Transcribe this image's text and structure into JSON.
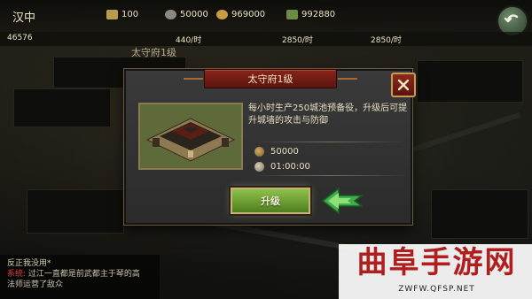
{
  "topbar": {
    "city_name": "汉中",
    "resources": [
      {
        "icon": "troop-icon",
        "value": "100"
      },
      {
        "icon": "silver-coin-icon",
        "value": "50000"
      },
      {
        "icon": "gold-coin-icon",
        "value": "969000"
      },
      {
        "icon": "grain-icon",
        "value": "992880"
      }
    ]
  },
  "stats": {
    "item1": "46576",
    "item2_val": "440/时",
    "item3_val": "2850/时",
    "item4_val": "2850/时"
  },
  "background_title": "太守府1级",
  "dialog": {
    "title": "太守府1级",
    "description": "每小时生产250城池预备役，升级后可提升城墙的攻击与防御",
    "cost": "50000",
    "time": "01:00:00",
    "upgrade_label": "升级"
  },
  "chat": {
    "line1": "反正我没用*",
    "sys_label": "系统:",
    "line2_text": "过江一直都是前武都主于琴的高",
    "line3": "法师运营了敌众"
  },
  "watermark": {
    "title": "曲阜手游网",
    "url": "ZWFW.QFSP.NET"
  },
  "colors": {
    "accent_red": "#8a2418",
    "upgrade_green": "#6ea234",
    "arrow_green": "#3fae4a",
    "watermark_red": "#b01e1e"
  }
}
